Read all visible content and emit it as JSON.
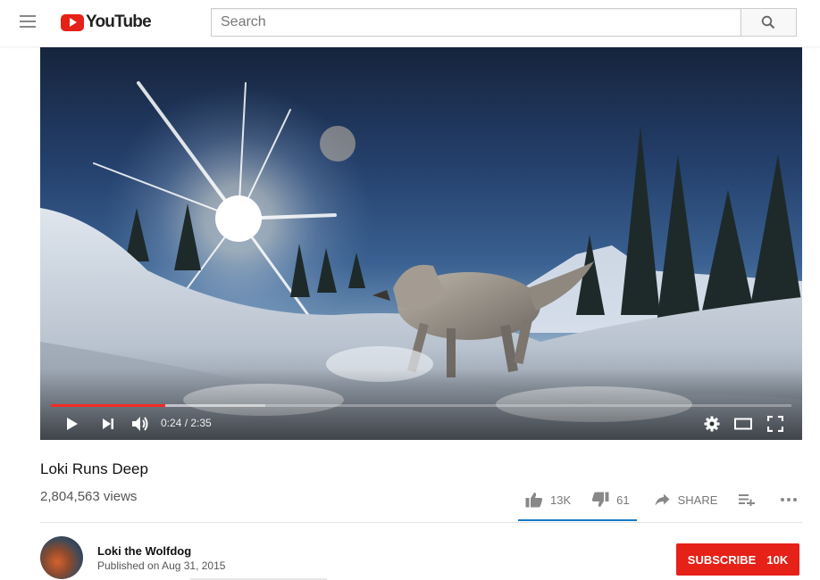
{
  "header": {
    "logo_text": "YouTube",
    "search_placeholder": "Search"
  },
  "player": {
    "current_time": "0:24",
    "duration": "2:35",
    "time_display": "0:24 / 2:35",
    "played_fraction": 0.155,
    "loaded_fraction": 0.29,
    "accent_color": "#f12b24",
    "controls": [
      "play-icon",
      "next-icon",
      "volume-icon",
      "settings-icon",
      "theater-icon",
      "fullscreen-icon"
    ]
  },
  "video": {
    "title": "Loki Runs Deep",
    "views": "2,804,563 views",
    "likes": "13K",
    "dislikes": "61",
    "share_label": "SHARE",
    "like_ratio": 0.9953
  },
  "channel": {
    "name": "Loki the Wolfdog",
    "published": "Published on Aug 31, 2015",
    "subscribe_label": "SUBSCRIBE",
    "subscriber_count": "10K",
    "subscribe_color": "#e62117"
  }
}
